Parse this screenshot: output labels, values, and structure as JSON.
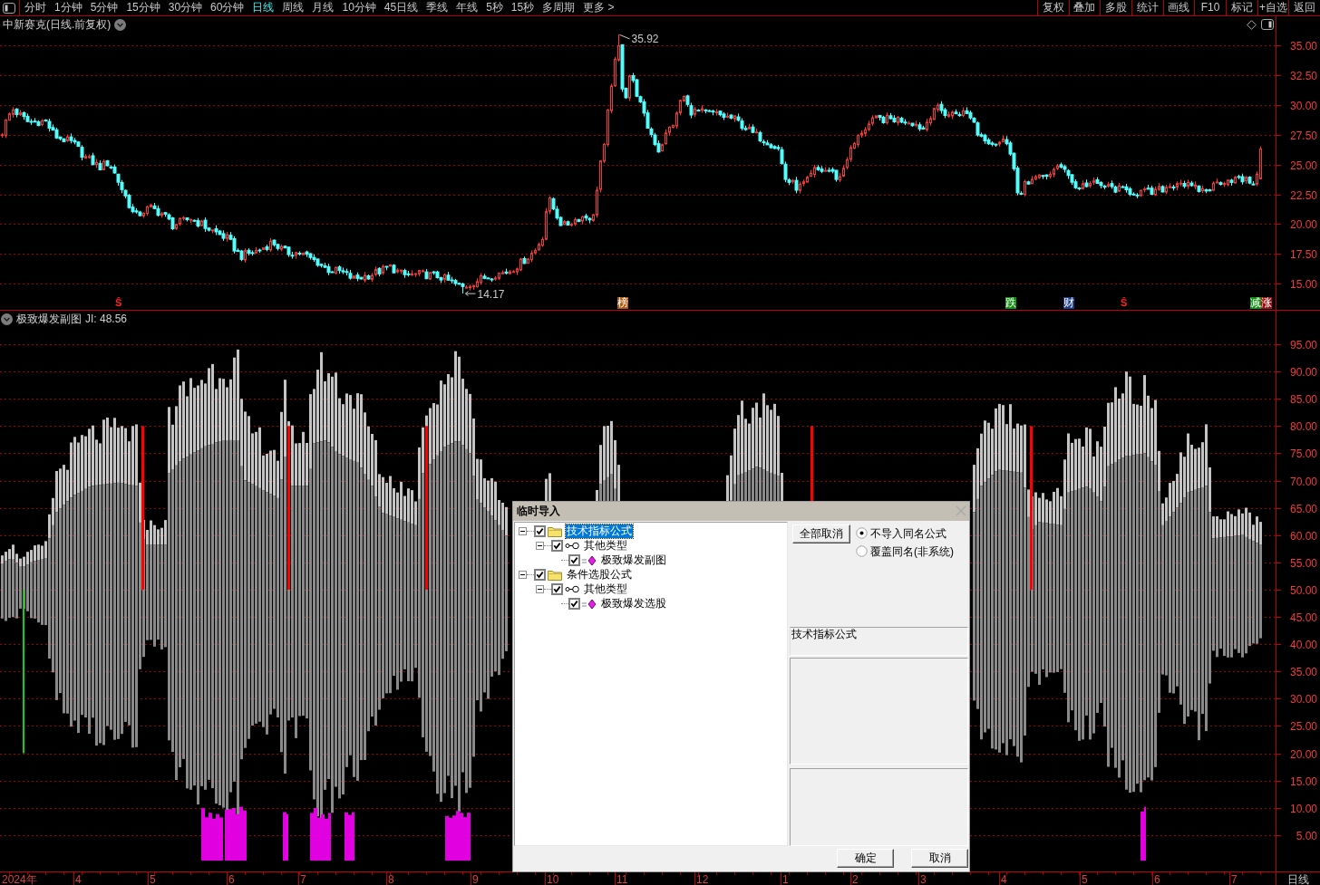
{
  "toolbar": {
    "period_tabs": [
      {
        "label": "分时",
        "selected": false
      },
      {
        "label": "1分钟",
        "selected": false
      },
      {
        "label": "5分钟",
        "selected": false
      },
      {
        "label": "15分钟",
        "selected": false
      },
      {
        "label": "30分钟",
        "selected": false
      },
      {
        "label": "60分钟",
        "selected": false
      },
      {
        "label": "日线",
        "selected": true
      },
      {
        "label": "周线",
        "selected": false
      },
      {
        "label": "月线",
        "selected": false
      },
      {
        "label": "10分钟",
        "selected": false
      },
      {
        "label": "45日线",
        "selected": false
      },
      {
        "label": "季线",
        "selected": false
      },
      {
        "label": "年线",
        "selected": false
      },
      {
        "label": "5秒",
        "selected": false
      },
      {
        "label": "15秒",
        "selected": false
      },
      {
        "label": "多周期",
        "selected": false
      },
      {
        "label": "更多 >",
        "selected": false
      }
    ],
    "tool_buttons": [
      "复权",
      "叠加",
      "多股",
      "统计",
      "画线",
      "F10",
      "标记",
      "+自选",
      "返回"
    ]
  },
  "price_pane": {
    "title": "中新赛克(日线.前复权)",
    "yticks": [
      "35.00",
      "32.50",
      "30.00",
      "27.50",
      "25.00",
      "22.50",
      "20.00",
      "17.50",
      "15.00"
    ],
    "high_label": "35.92",
    "low_label": "14.17",
    "event_marks": [
      {
        "label": "Ŝ",
        "kind": "plain",
        "color": "#ff2020"
      },
      {
        "label": "榜",
        "kind": "tag",
        "color": "#b05a10"
      },
      {
        "label": "跌",
        "kind": "tag",
        "color": "#109010"
      },
      {
        "label": "财",
        "kind": "tag",
        "color": "#1c3c8c"
      },
      {
        "label": "Ŝ",
        "kind": "plain",
        "color": "#ff2020"
      },
      {
        "label": "减",
        "kind": "tag",
        "color": "#109010"
      },
      {
        "label": "涨",
        "kind": "tag",
        "color": "#a01010"
      }
    ]
  },
  "indicator_pane": {
    "title": "极致爆发副图",
    "reading": "JI: 48.56",
    "yticks": [
      "95.00",
      "90.00",
      "85.00",
      "80.00",
      "75.00",
      "70.00",
      "65.00",
      "60.00",
      "55.00",
      "50.00",
      "45.00",
      "40.00",
      "35.00",
      "30.00",
      "25.00",
      "20.00",
      "15.00",
      "10.00",
      "5.00"
    ]
  },
  "time_axis": {
    "labels": [
      "2024年",
      "4",
      "5",
      "6",
      "7",
      "8",
      "9",
      "10",
      "11",
      "12",
      "1",
      "2",
      "3",
      "4",
      "5",
      "6",
      "7"
    ],
    "period": "日线"
  },
  "dialog": {
    "title": "临时导入",
    "tree": [
      {
        "label": "技术指标公式",
        "checked": true,
        "expanded": true,
        "selected": true,
        "children": [
          {
            "label": "其他类型",
            "checked": true,
            "expanded": true,
            "selected": false,
            "children": [
              {
                "label": "极致爆发副图",
                "checked": true,
                "selected": false
              }
            ]
          }
        ]
      },
      {
        "label": "条件选股公式",
        "checked": true,
        "expanded": true,
        "selected": false,
        "children": [
          {
            "label": "其他类型",
            "checked": true,
            "expanded": true,
            "selected": false,
            "children": [
              {
                "label": "极致爆发选股",
                "checked": true,
                "selected": false
              }
            ]
          }
        ]
      }
    ],
    "deselect_all_button": "全部取消",
    "options": [
      {
        "label": "不导入同名公式",
        "selected": true
      },
      {
        "label": "覆盖同名(非系统)",
        "selected": false
      }
    ],
    "category": "技术指标公式",
    "buttons": [
      "确定",
      "取消"
    ]
  }
}
